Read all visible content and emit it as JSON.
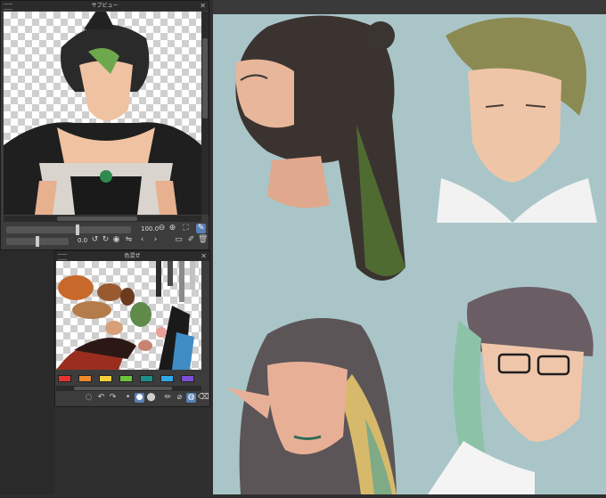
{
  "subview": {
    "title": "サブビュー",
    "zoom_value": "100.0",
    "rotate_value": "0.0"
  },
  "color_set": {
    "title": "色混ぜ",
    "swatches": [
      "#e8322e",
      "#f08a2a",
      "#f5d23a",
      "#6dc43c",
      "#1c8f8a",
      "#2fa8e6",
      "#7c4fd8"
    ]
  },
  "colors": {
    "canvas_bg": "#a9c5c8",
    "panel_bg": "#3c3c3c",
    "accent": "#5a7fb3"
  },
  "icons": [
    "close-icon",
    "zoom-out-icon",
    "zoom-in-icon",
    "fit-icon",
    "eyedropper-icon",
    "rotate-left-icon",
    "rotate-right-icon",
    "reset-icon",
    "flip-icon",
    "prev-icon",
    "next-icon",
    "open-file-icon",
    "delete-icon",
    "brush-icon",
    "eraser-icon"
  ]
}
